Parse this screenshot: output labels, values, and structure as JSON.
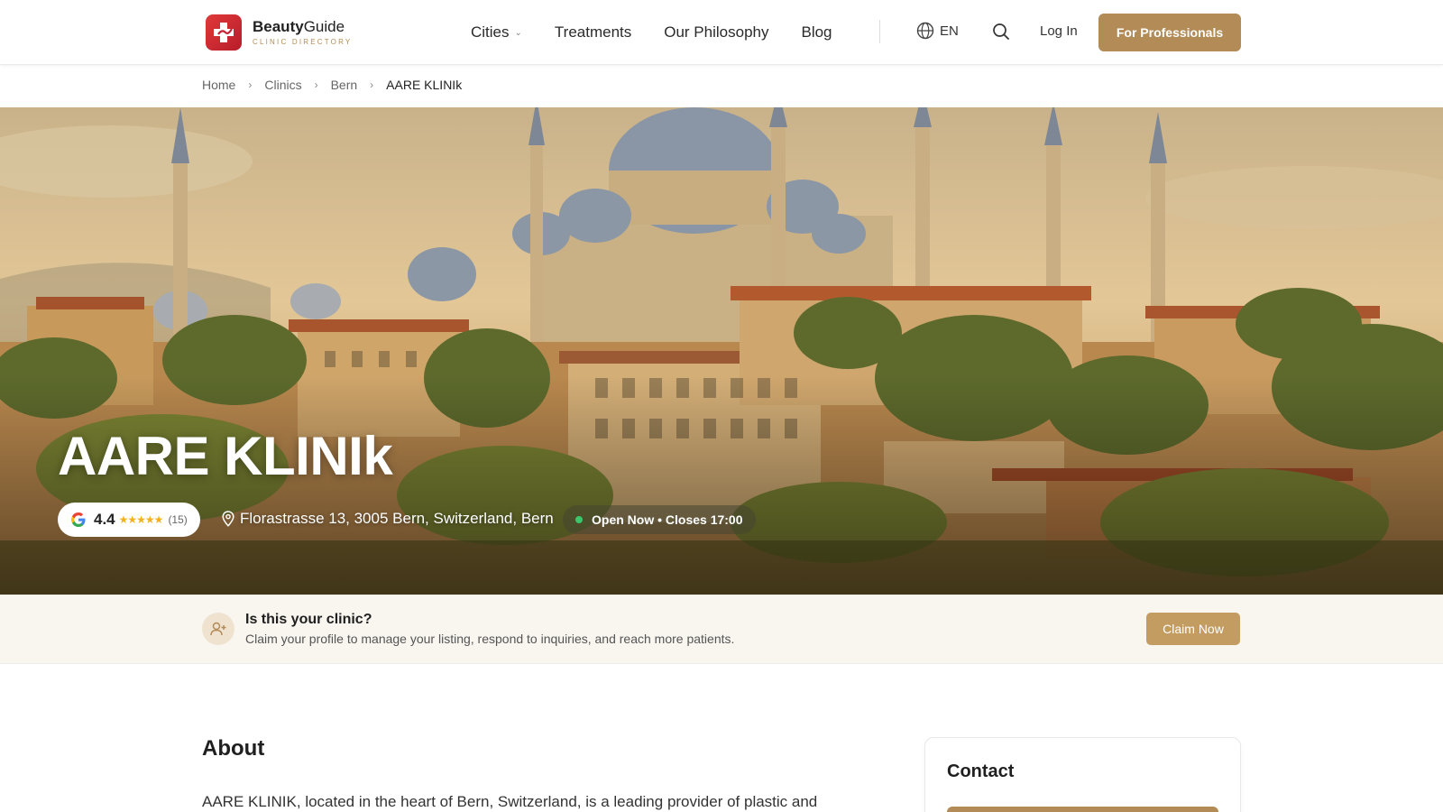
{
  "header": {
    "logo": {
      "name_bold": "Beauty",
      "name_rest": "Guide",
      "subtitle": "CLINIC DIRECTORY"
    },
    "nav": [
      {
        "label": "Cities",
        "has_dropdown": true
      },
      {
        "label": "Treatments"
      },
      {
        "label": "Our Philosophy"
      },
      {
        "label": "Blog"
      }
    ],
    "language": "EN",
    "login_label": "Log In",
    "professionals_label": "For Professionals",
    "accent_color": "#b38b57"
  },
  "breadcrumb": [
    "Home",
    "Clinics",
    "Bern",
    "AARE KLINIk"
  ],
  "hero": {
    "title": "AARE KLINIk",
    "rating": "4.4",
    "stars": "★★★★★",
    "review_count": "(15)",
    "address": "Florastrasse 13, 3005 Bern, Switzerland, Bern",
    "status": "Open Now • Closes 17:00",
    "status_color": "#3ac66b"
  },
  "claim": {
    "title": "Is this your clinic?",
    "text": "Claim your profile to manage your listing, respond to inquiries, and reach more patients.",
    "button": "Claim Now"
  },
  "about": {
    "title": "About",
    "text": "AARE KLINIK, located in the heart of Bern, Switzerland, is a leading provider of plastic and"
  },
  "contact": {
    "title": "Contact"
  },
  "icons": {
    "logo": "medical-cross-icon",
    "globe": "globe-icon",
    "search": "search-icon",
    "google": "google-icon",
    "location": "map-pin-icon",
    "claim": "user-plus-icon"
  }
}
